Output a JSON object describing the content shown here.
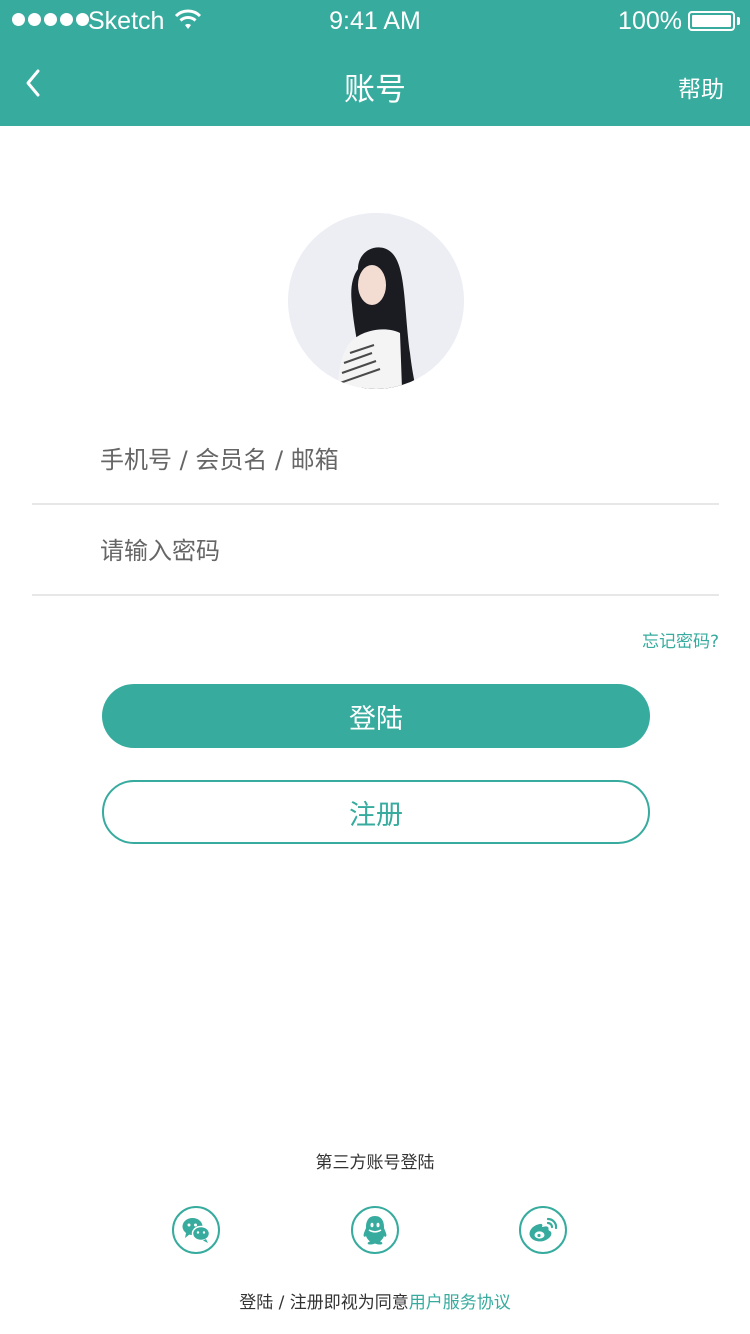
{
  "status_bar": {
    "carrier": "Sketch",
    "time": "9:41 AM",
    "battery": "100%"
  },
  "nav": {
    "title": "账号",
    "help": "帮助"
  },
  "form": {
    "account_placeholder": "手机号 / 会员名 / 邮箱",
    "password_placeholder": "请输入密码",
    "forgot": "忘记密码?"
  },
  "buttons": {
    "login": "登陆",
    "register": "注册"
  },
  "third_party": {
    "title": "第三方账号登陆",
    "icons": [
      "wechat-icon",
      "qq-icon",
      "weibo-icon"
    ]
  },
  "agreement": {
    "prefix": "登陆 / 注册即视为同意",
    "link": "用户服务协议"
  },
  "colors": {
    "brand": "#36ab9e",
    "text": "#333333",
    "divider": "#e7e7e7"
  }
}
